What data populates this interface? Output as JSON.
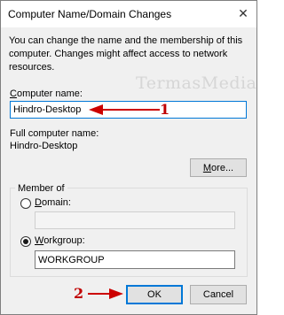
{
  "window": {
    "title": "Computer Name/Domain Changes",
    "close_glyph": "✕"
  },
  "description": "You can change the name and the membership of this computer. Changes might affect access to network resources.",
  "computer_name": {
    "label_prefix": "",
    "label_access": "C",
    "label_rest": "omputer name:",
    "value": "Hindro-Desktop"
  },
  "full_name": {
    "label": "Full computer name:",
    "value": "Hindro-Desktop"
  },
  "more_button": {
    "access": "M",
    "rest": "ore..."
  },
  "member_of": {
    "title": "Member of",
    "domain": {
      "access": "D",
      "rest": "omain:",
      "value": "",
      "selected": false
    },
    "workgroup": {
      "access": "W",
      "rest": "orkgroup:",
      "value": "WORKGROUP",
      "selected": true
    }
  },
  "buttons": {
    "ok": "OK",
    "cancel": "Cancel"
  },
  "watermark": "TermasMedia",
  "annotations": {
    "step1": "1",
    "step2": "2",
    "arrow_color": "#cc0000"
  }
}
